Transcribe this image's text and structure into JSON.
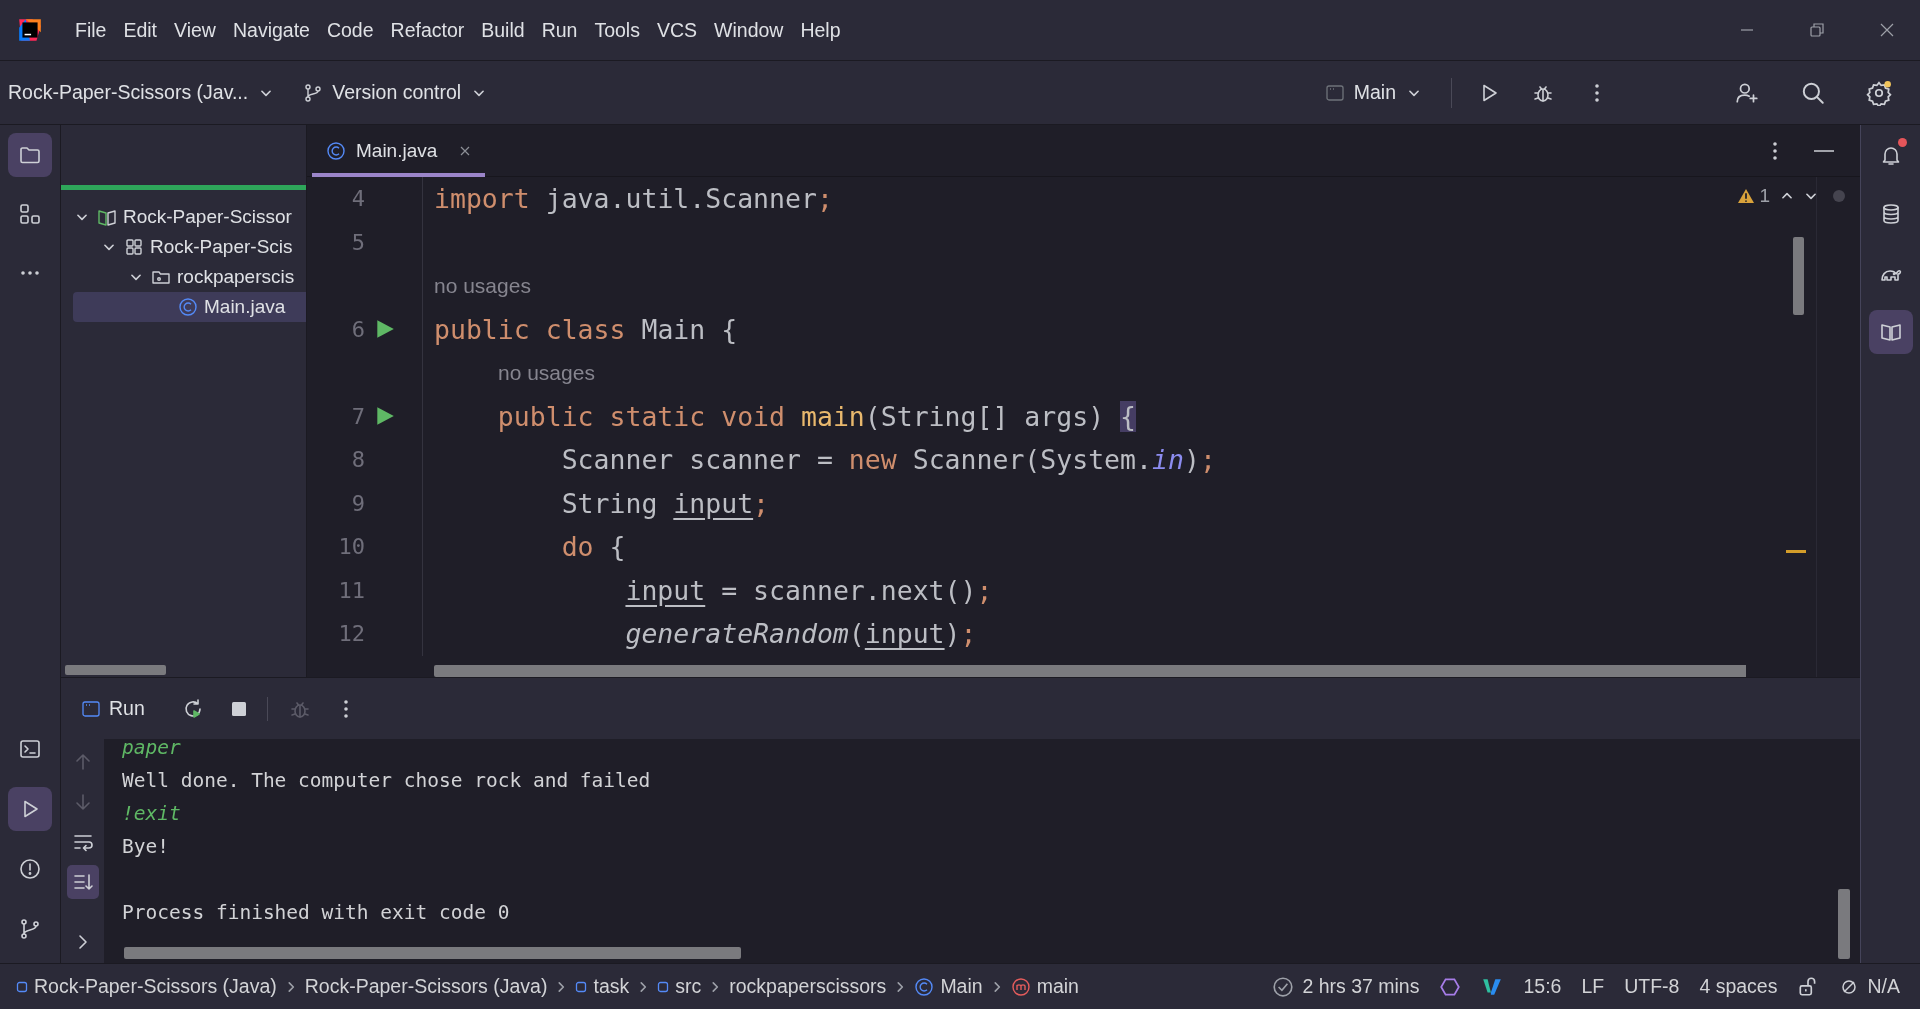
{
  "menu": [
    "File",
    "Edit",
    "View",
    "Navigate",
    "Code",
    "Refactor",
    "Build",
    "Run",
    "Tools",
    "VCS",
    "Window",
    "Help"
  ],
  "toolbar": {
    "project": "Rock-Paper-Scissors (Jav...",
    "vcs": "Version control",
    "run_config": "Main"
  },
  "left_strip": {
    "top": [
      {
        "kind": "folder",
        "selected": true
      },
      {
        "kind": "structure",
        "selected": false
      },
      {
        "kind": "more",
        "selected": false
      }
    ],
    "bottom": [
      {
        "kind": "terminal",
        "selected": false
      },
      {
        "kind": "run",
        "selected": true
      },
      {
        "kind": "problems",
        "selected": false
      },
      {
        "kind": "git",
        "selected": false
      }
    ]
  },
  "right_strip": [
    {
      "kind": "bell",
      "selected": false,
      "badge": true
    },
    {
      "kind": "database",
      "selected": false,
      "badge": false
    },
    {
      "kind": "elephant",
      "selected": false,
      "badge": false
    },
    {
      "kind": "book",
      "selected": true,
      "badge": false
    }
  ],
  "project_progress": {
    "on": true
  },
  "project_tree": [
    {
      "label": "Rock-Paper-Scissor",
      "kind": "project",
      "expanded": true,
      "selected": false,
      "children": [
        {
          "label": "Rock-Paper-Scis",
          "kind": "module",
          "expanded": true,
          "selected": false,
          "children": [
            {
              "label": "rockpaperscis",
              "kind": "package",
              "expanded": true,
              "selected": false,
              "children": [
                {
                  "label": "Main.java",
                  "kind": "class",
                  "selected": true
                }
              ]
            }
          ]
        }
      ]
    }
  ],
  "tabs": [
    {
      "label": "Main.java",
      "selected": true
    }
  ],
  "inspections": {
    "warnings": "1"
  },
  "editor_lines": [
    {
      "number": "4",
      "runnable": false,
      "tokens": [
        {
          "text": "import",
          "kind": "kw"
        },
        {
          "text": " java.util.Scanner",
          "kind": "plain"
        },
        {
          "text": ";",
          "kind": "semi"
        }
      ]
    },
    {
      "number": "5",
      "runnable": false
    },
    {
      "number": "6",
      "runnable": true,
      "hint": "no usages",
      "tokens": [
        {
          "text": "public class",
          "kind": "kw"
        },
        {
          "text": " Main {",
          "kind": "plain"
        }
      ]
    },
    {
      "number": "7",
      "runnable": true,
      "hint": "no usages",
      "tokens": [
        {
          "text": "    public static void ",
          "kind": "kw"
        },
        {
          "text": "main",
          "kind": "method"
        },
        {
          "text": "(String[] args) ",
          "kind": "plain"
        },
        {
          "text": "{",
          "kind": "match"
        }
      ]
    },
    {
      "number": "8",
      "runnable": false,
      "tokens": [
        {
          "text": "        Scanner scanner = ",
          "kind": "plain"
        },
        {
          "text": "new",
          "kind": "kw"
        },
        {
          "text": " Scanner(System.",
          "kind": "plain"
        },
        {
          "text": "in",
          "kind": "field"
        },
        {
          "text": ")",
          "kind": "plain"
        },
        {
          "text": ";",
          "kind": "semi"
        }
      ]
    },
    {
      "number": "9",
      "runnable": false,
      "tokens": [
        {
          "text": "        String ",
          "kind": "plain"
        },
        {
          "text": "input",
          "kind": "var"
        },
        {
          "text": ";",
          "kind": "semi"
        }
      ]
    },
    {
      "number": "10",
      "runnable": false,
      "tokens": [
        {
          "text": "        do",
          "kind": "kw"
        },
        {
          "text": " {",
          "kind": "plain"
        }
      ]
    },
    {
      "number": "11",
      "runnable": false,
      "tokens": [
        {
          "text": "            input",
          "kind": "var"
        },
        {
          "text": " = scanner.next()",
          "kind": "plain"
        },
        {
          "text": ";",
          "kind": "semi"
        }
      ]
    },
    {
      "number": "12",
      "runnable": false,
      "tokens": [
        {
          "text": "            generateRandom",
          "kind": "call"
        },
        {
          "text": "(",
          "kind": "plain"
        },
        {
          "text": "input",
          "kind": "var"
        },
        {
          "text": ")",
          "kind": "plain"
        },
        {
          "text": ";",
          "kind": "semi"
        }
      ]
    }
  ],
  "run_panel": {
    "title": "Run",
    "tools": [
      {
        "kind": "rerun",
        "disabled": false
      },
      {
        "kind": "stop",
        "disabled": false
      },
      {
        "kind": "debug",
        "disabled": true
      },
      {
        "kind": "more",
        "disabled": false
      }
    ],
    "side_tools": [
      {
        "kind": "up",
        "selected": false
      },
      {
        "kind": "down",
        "selected": false
      },
      {
        "kind": "wrap",
        "selected": false
      },
      {
        "kind": "scroll-end",
        "selected": true
      },
      {
        "kind": "expand",
        "selected": false
      }
    ],
    "console": [
      {
        "text": "paper",
        "kind": "input"
      },
      {
        "text": "Well done. The computer chose rock and failed",
        "kind": "output"
      },
      {
        "text": "!exit",
        "kind": "input"
      },
      {
        "text": "Bye!",
        "kind": "output"
      },
      {
        "text": "Process finished with exit code 0",
        "kind": "status"
      }
    ]
  },
  "breadcrumbs": [
    {
      "text": "Rock-Paper-Scissors (Java)",
      "kind": "module"
    },
    {
      "text": "Rock-Paper-Scissors (Java)",
      "kind": "project"
    },
    {
      "text": "task",
      "kind": "module"
    },
    {
      "text": "src",
      "kind": "module"
    },
    {
      "text": "rockpaperscissors",
      "kind": "package"
    },
    {
      "text": "Main",
      "kind": "class"
    },
    {
      "text": "main",
      "kind": "method"
    }
  ],
  "status": {
    "timer": "2 hrs 37 mins",
    "position": "15:6",
    "line_separator": "LF",
    "encoding": "UTF-8",
    "indent": "4 spaces",
    "widget": "N/A"
  }
}
